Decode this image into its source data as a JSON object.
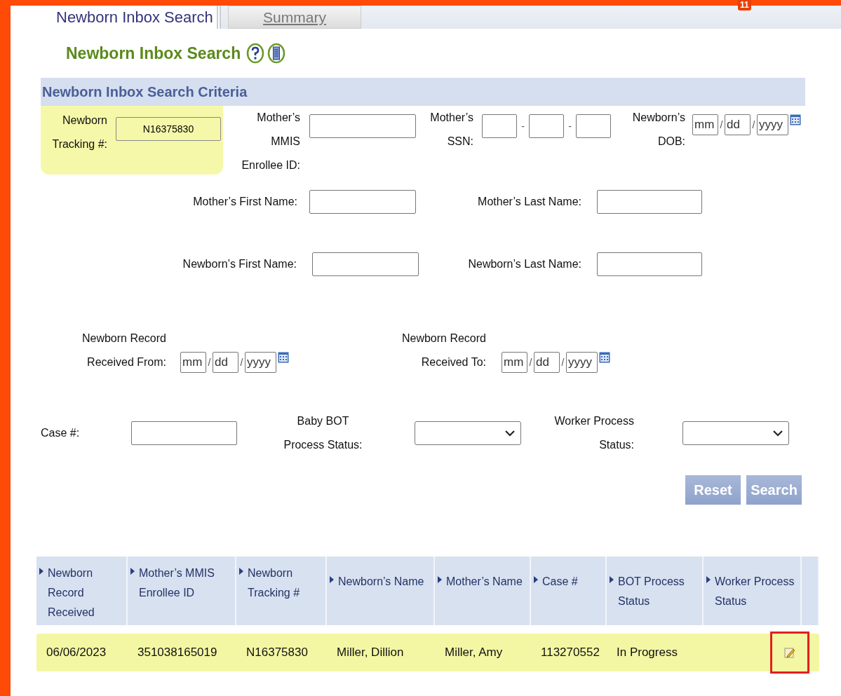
{
  "page_number": "11",
  "tabs": [
    {
      "label": "Newborn Inbox Search",
      "selected": true
    },
    {
      "label": "Summary",
      "selected": false
    }
  ],
  "heading": "Newborn Inbox Search",
  "criteria": {
    "title": "Newborn Inbox Search Criteria",
    "fields": [
      {
        "kind": "text",
        "label": "Newborn Tracking #:",
        "value": "N16375830",
        "highlighted": true
      },
      {
        "kind": "text",
        "label": "Mother’s MMIS Enrollee ID:"
      },
      {
        "kind": "ssn",
        "label": "Mother’s SSN:",
        "separators": [
          "-",
          "-"
        ]
      },
      {
        "kind": "date",
        "label": "Newborn’s DOB:",
        "placeholders": [
          "mm",
          "dd",
          "yyyy"
        ],
        "separators": [
          "/",
          "/"
        ]
      },
      {
        "kind": "text",
        "label": "Mother’s First Name:"
      },
      {
        "kind": "text",
        "label": "Mother’s Last Name:"
      },
      {
        "kind": "text",
        "label": "Newborn’s First Name:"
      },
      {
        "kind": "text",
        "label": "Newborn’s Last Name:"
      },
      {
        "kind": "date",
        "label": "Newborn Record Received From:",
        "placeholders": [
          "mm",
          "dd",
          "yyyy"
        ],
        "separators": [
          "/",
          "/"
        ]
      },
      {
        "kind": "date",
        "label": "Newborn Record Received To:",
        "placeholders": [
          "mm",
          "dd",
          "yyyy"
        ],
        "separators": [
          "/",
          "/"
        ]
      },
      {
        "kind": "text",
        "label": "Case #:"
      },
      {
        "kind": "select",
        "label": "Baby BOT Process Status:"
      },
      {
        "kind": "select",
        "label": "Worker Process Status:"
      }
    ],
    "buttons": [
      "Reset",
      "Search"
    ]
  },
  "table": {
    "columns": [
      "Newborn Record Received",
      "Mother’s MMIS Enrollee ID",
      "Newborn Tracking #",
      "Newborn’s Name",
      "Mother’s Name",
      "Case #",
      "BOT Process Status",
      "Worker Process Status"
    ],
    "rows": [
      {
        "cells": [
          "06/06/2023",
          "351038165019",
          "N16375830",
          "Miller, Dillion",
          "Miller, Amy",
          "113270552",
          "In Progress"
        ],
        "highlighted": true,
        "action_marked": true
      }
    ]
  }
}
